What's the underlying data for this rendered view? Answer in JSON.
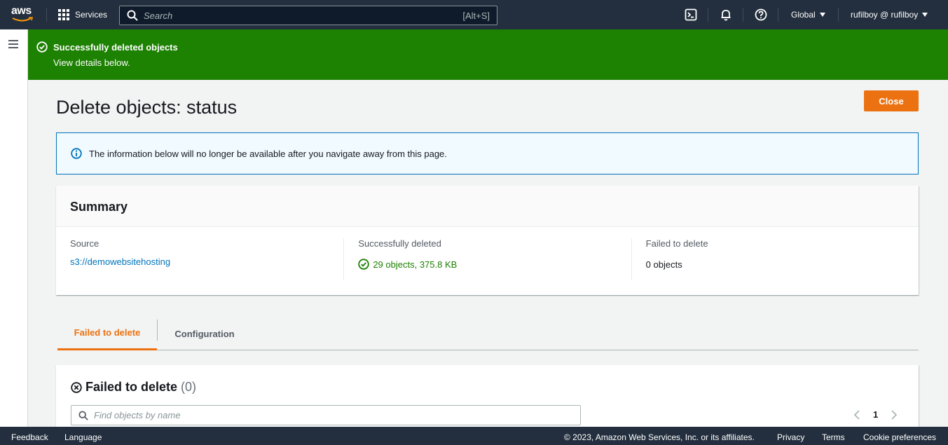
{
  "topnav": {
    "logo_text": "aws",
    "services_label": "Services",
    "search_placeholder": "Search",
    "search_shortcut": "[Alt+S]",
    "region_label": "Global",
    "account_label": "rufilboy @ rufilboy"
  },
  "flash": {
    "title": "Successfully deleted objects",
    "subtitle": "View details below.",
    "color": "#1d8102"
  },
  "main": {
    "page_title": "Delete objects: status",
    "close_label": "Close",
    "info_text": "The information below will no longer be available after you navigate away from this page."
  },
  "summary": {
    "heading": "Summary",
    "source_label": "Source",
    "source_value": "s3://demowebsitehosting",
    "deleted_label": "Successfully deleted",
    "deleted_value": "29 objects, 375.8 KB",
    "failed_label": "Failed to delete",
    "failed_value": "0 objects"
  },
  "tabs": [
    {
      "label": "Failed to delete",
      "active": true
    },
    {
      "label": "Configuration",
      "active": false
    }
  ],
  "failed_panel": {
    "title": "Failed to delete",
    "count": "(0)",
    "search_placeholder": "Find objects by name",
    "page_number": "1"
  },
  "footer": {
    "feedback": "Feedback",
    "language": "Language",
    "copyright": "© 2023, Amazon Web Services, Inc. or its affiliates.",
    "privacy": "Privacy",
    "terms": "Terms",
    "cookies": "Cookie preferences"
  },
  "colors": {
    "nav_bg": "#232f3e",
    "accent": "#ec7211",
    "link": "#0073bb",
    "success": "#1d8102"
  }
}
